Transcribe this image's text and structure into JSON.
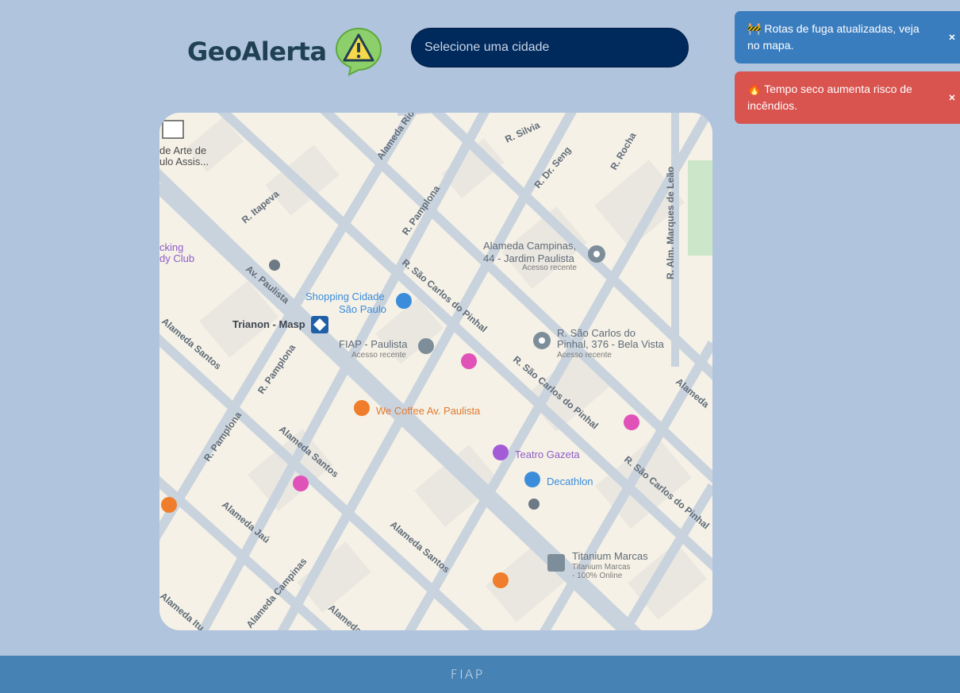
{
  "header": {
    "brand": "GeoAlerta",
    "city_select_placeholder": "Selecione uma cidade"
  },
  "notifications": [
    {
      "icon": "🚧",
      "text": "Rotas de fuga atualizadas, veja no mapa.",
      "close": "×"
    },
    {
      "icon": "🔥",
      "text": "Tempo seco aumenta risco de incêndios.",
      "close": "×"
    }
  ],
  "map": {
    "streets": [
      "Alameda Rio Claro",
      "R. Silvia",
      "R. Dr. Seng",
      "R. Rocha",
      "R. Itapeva",
      "R. Pamplona",
      "R. Alm. Marques de Leão",
      "Av. Paulista",
      "R. São Carlos do Pinhal",
      "Alameda Santos",
      "Alameda Jaú",
      "Alameda Campinas",
      "Alameda Itu",
      "Alameda"
    ],
    "places": {
      "museum": "de Arte de\nulo Assis...",
      "club": "cking\ndy Club",
      "alameda_campinas_addr": "Alameda Campinas,\n44 - Jardim Paulista",
      "alameda_campinas_recent": "Acesso recente",
      "shopping": "Shopping Cidade\nSão Paulo",
      "trianon": "Trianon - Masp",
      "fiap": "FIAP - Paulista",
      "fiap_recent": "Acesso recente",
      "sao_carlos_addr": "R. São Carlos do\nPinhal, 376 - Bela Vista",
      "sao_carlos_recent": "Acesso recente",
      "we_coffee": "We Coffee Av. Paulista",
      "teatro": "Teatro Gazeta",
      "decathlon": "Decathlon",
      "titanium": "Titanium Marcas",
      "titanium_sub": "Titanium Marcas\n- 100% Online"
    },
    "colors": {
      "road": "#c8d2dc",
      "block": "#f7f3ea",
      "building": "#e6e4e0",
      "park": "#cbe6c8"
    }
  },
  "footer": {
    "brand": "FIAP"
  }
}
